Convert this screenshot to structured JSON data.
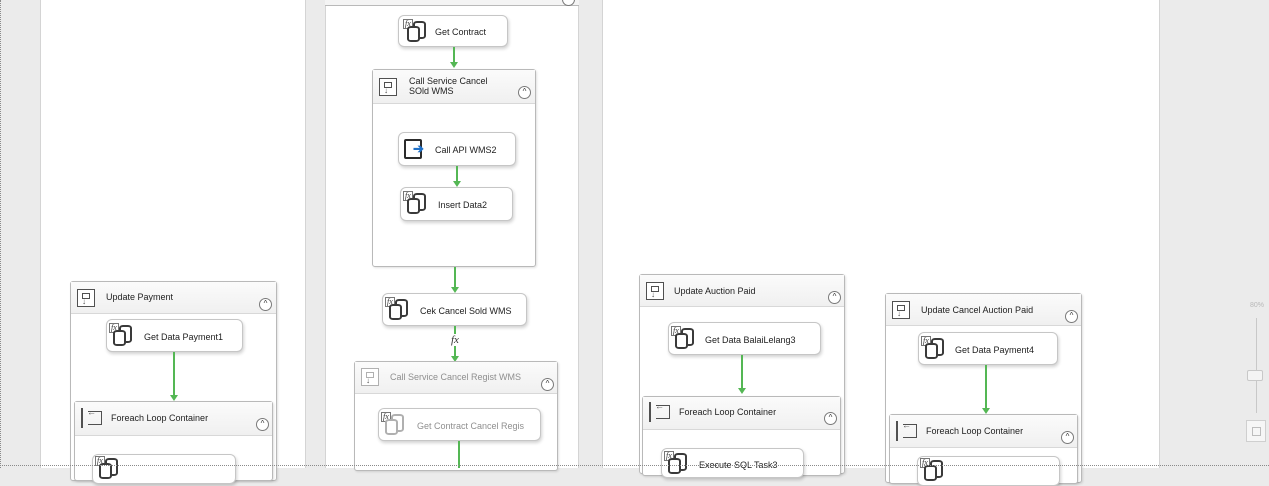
{
  "designer": {
    "zoom_label": "80%"
  },
  "lane2": {
    "get_contract": "Get Contract",
    "seq_cancel_sold": "Call Service Cancel\nSOld WMS",
    "call_api_wms2": "Call API WMS2",
    "insert_data2": "Insert Data2",
    "cek_cancel_sold": "Cek Cancel Sold WMS",
    "expression_symbol": "fx",
    "seq_cancel_regist": "Call Service Cancel Regist WMS",
    "get_contract_cancel_regis": "Get Contract Cancel Regis"
  },
  "lane1": {
    "update_payment": "Update Payment",
    "get_data_payment1": "Get Data Payment1",
    "foreach_loop": "Foreach Loop Container"
  },
  "lane3": {
    "update_auction_paid": "Update Auction Paid",
    "get_data_balai": "Get Data BalaiLelang3",
    "foreach_loop": "Foreach Loop Container",
    "execute_sql_task3": "Execute SQL Task3"
  },
  "lane4": {
    "update_cancel_auction": "Update Cancel Auction Paid",
    "get_data_payment4": "Get Data Payment4",
    "foreach_loop": "Foreach Loop Container"
  },
  "icons": {
    "sequence": "sequence-container-icon",
    "foreach": "foreach-loop-icon",
    "sql_task": "execute-sql-task-icon",
    "script": "script-task-icon",
    "collapse": "collapse-chevron-icon"
  },
  "colors": {
    "precedence_success": "#54b754",
    "canvas": "#ffffff",
    "background": "#ebebeb"
  }
}
